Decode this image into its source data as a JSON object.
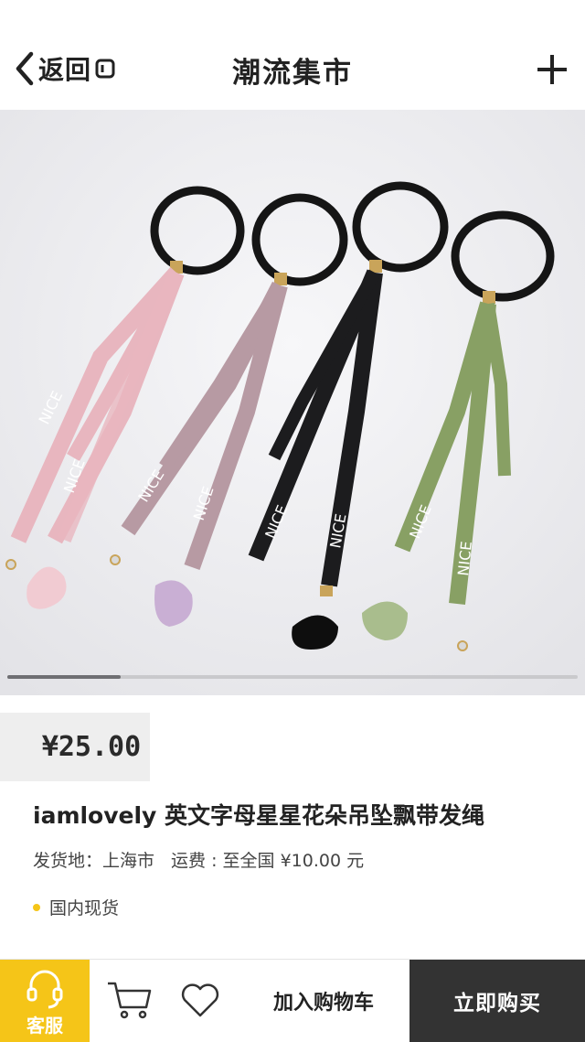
{
  "header": {
    "back_label": "返回",
    "title": "潮流集市"
  },
  "product": {
    "price": "¥25.00",
    "name": "iamlovely 英文字母星星花朵吊坠飘带发绳",
    "shipping_from_label": "发货地：",
    "shipping_from": "上海市",
    "shipping_fee_label": "运费 : 至全国",
    "shipping_fee": "¥10.00 元",
    "stock_tag": "国内现货",
    "ribbon_text": "NICE",
    "gallery_position": 0.2
  },
  "bottom_bar": {
    "service_label": "客服",
    "add_to_cart_label": "加入购物车",
    "buy_now_label": "立即购买"
  },
  "colors": {
    "accent": "#f5c518",
    "buy_button": "#333333",
    "ribbon_pink": "#e8b6bf",
    "ribbon_mauve": "#b79aa3",
    "ribbon_black": "#1c1c1e",
    "ribbon_green": "#88a064"
  },
  "icons": {
    "back": "chevron-left-icon",
    "add": "plus-icon",
    "service": "headset-icon",
    "cart": "cart-icon",
    "favorite": "heart-icon"
  }
}
